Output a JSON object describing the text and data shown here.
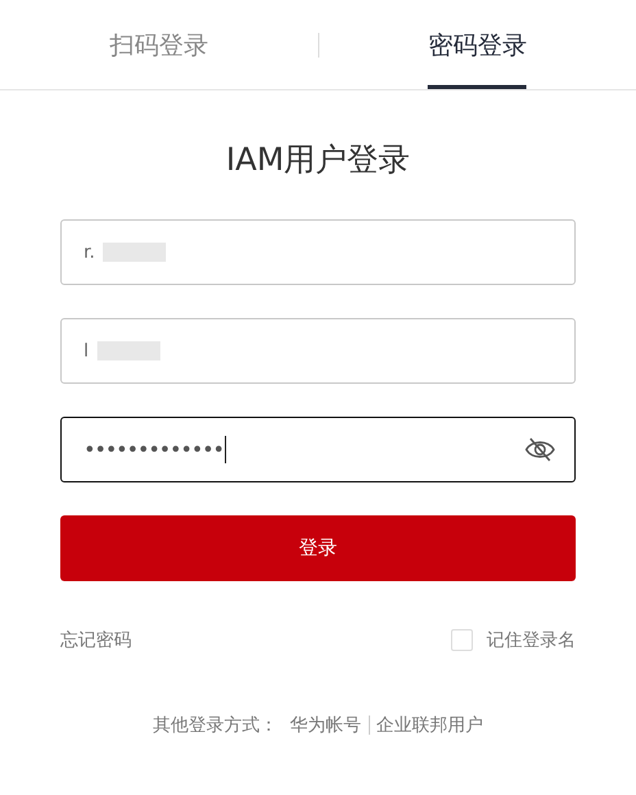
{
  "tabs": [
    {
      "label": "扫码登录",
      "selected": false
    },
    {
      "label": "密码登录",
      "selected": true
    }
  ],
  "title": "IAM用户登录",
  "fields": [
    {
      "kind": "text",
      "value": "r.",
      "redacted": true,
      "focused": false
    },
    {
      "kind": "text",
      "value": "l",
      "redacted": true,
      "focused": false
    },
    {
      "kind": "password",
      "value": "•••••••••••••",
      "redacted": false,
      "focused": true
    }
  ],
  "login_button": "登录",
  "forgot_password": "忘记密码",
  "remember": {
    "label": "记住登录名",
    "checked": false
  },
  "other_login": {
    "label": "其他登录方式：",
    "links": [
      "华为帐号",
      "企业联邦用户"
    ]
  }
}
